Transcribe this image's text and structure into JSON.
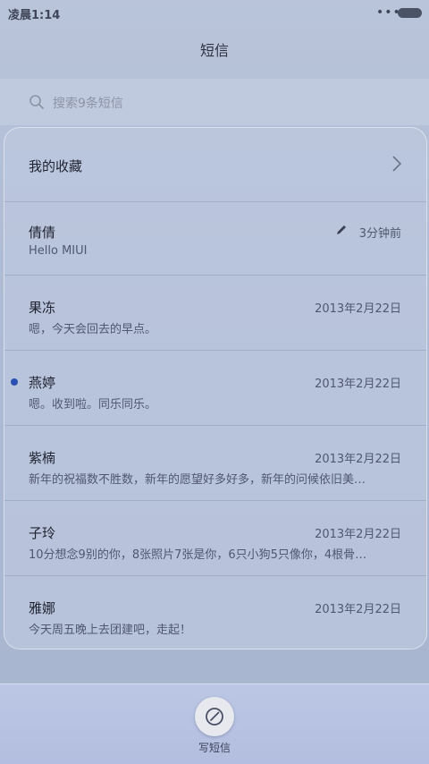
{
  "status": {
    "time": "凌晨1:14",
    "dots": "•••"
  },
  "header": {
    "title": "短信"
  },
  "search": {
    "placeholder": "搜索9条短信"
  },
  "favorites": {
    "label": "我的收藏"
  },
  "threads": [
    {
      "name": "倩倩",
      "preview": "Hello MIUI",
      "date": "3分钟前",
      "draft": true,
      "unread": false
    },
    {
      "name": "果冻",
      "preview": "嗯，今天会回去的早点。",
      "date": "2013年2月22日",
      "draft": false,
      "unread": false
    },
    {
      "name": "燕婷",
      "preview": "嗯。收到啦。同乐同乐。",
      "date": "2013年2月22日",
      "draft": false,
      "unread": true
    },
    {
      "name": "紫楠",
      "preview": "新年的祝福数不胜数，新年的愿望好多好多，新年的问候依旧美…",
      "date": "2013年2月22日",
      "draft": false,
      "unread": false
    },
    {
      "name": "子玲",
      "preview": "10分想念9别的你，8张照片7张是你，6只小狗5只像你，4根骨…",
      "date": "2013年2月22日",
      "draft": false,
      "unread": false
    },
    {
      "name": "雅娜",
      "preview": "今天周五晚上去团建吧，走起！",
      "date": "2013年2月22日",
      "draft": false,
      "unread": false
    }
  ],
  "bottom": {
    "compose_label": "写短信"
  },
  "colors": {
    "accent": "#2b4fb3",
    "background": "#aebbd4"
  }
}
